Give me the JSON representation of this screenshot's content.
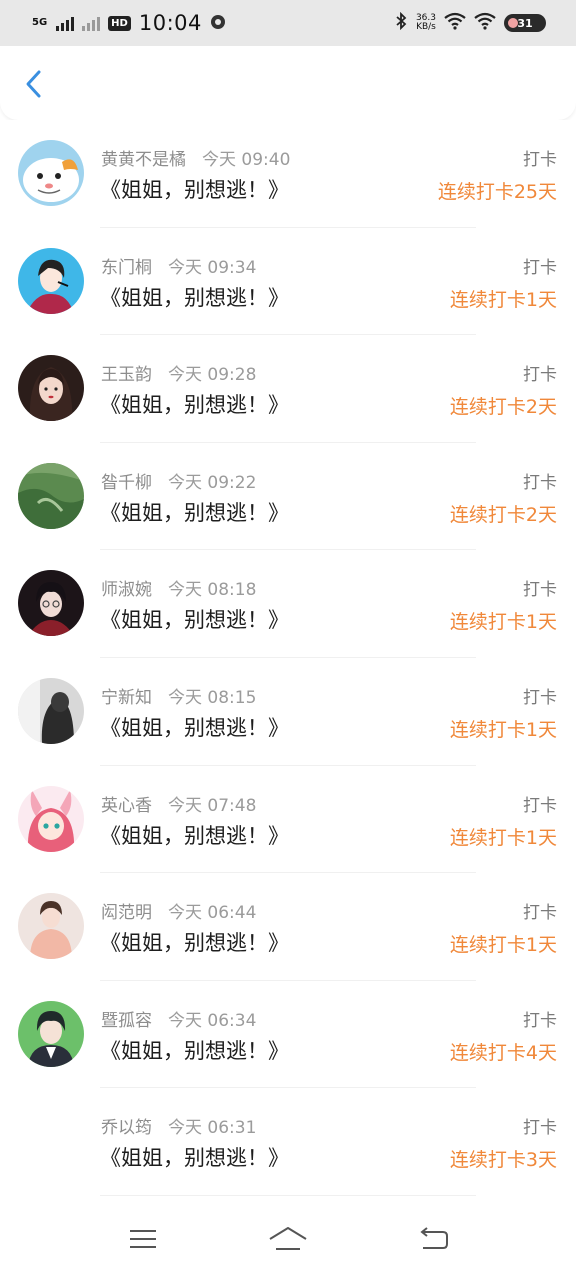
{
  "status_bar": {
    "network": "5G",
    "hd": "HD",
    "time": "10:04",
    "speed_value": "36.3",
    "speed_unit": "KB/s",
    "battery": "31"
  },
  "icons": {
    "back": "chevron-left-icon",
    "menu": "menu-icon",
    "home": "home-icon",
    "return": "return-icon"
  },
  "colors": {
    "accent": "#3a8fe0",
    "streak": "#f0883a",
    "meta": "#8d8d8d"
  },
  "feed": [
    {
      "name": "黄黄不是橘",
      "time": "今天 09:40",
      "book": "《姐姐，别想逃！》",
      "tag": "打卡",
      "streak": "连续打卡25天",
      "avatar": "hamster-cartoon"
    },
    {
      "name": "东门桐",
      "time": "今天 09:34",
      "book": "《姐姐，别想逃！》",
      "tag": "打卡",
      "streak": "连续打卡1天",
      "avatar": "illustrated-woman"
    },
    {
      "name": "王玉韵",
      "time": "今天 09:28",
      "book": "《姐姐，别想逃！》",
      "tag": "打卡",
      "streak": "连续打卡2天",
      "avatar": "anime-girl-dark"
    },
    {
      "name": "昝千柳",
      "time": "今天 09:22",
      "book": "《姐姐，别想逃！》",
      "tag": "打卡",
      "streak": "连续打卡2天",
      "avatar": "green-mountain"
    },
    {
      "name": "师淑婉",
      "time": "今天 08:18",
      "book": "《姐姐，别想逃！》",
      "tag": "打卡",
      "streak": "连续打卡1天",
      "avatar": "anime-boy-dark"
    },
    {
      "name": "宁新知",
      "time": "今天 08:15",
      "book": "《姐姐，别想逃！》",
      "tag": "打卡",
      "streak": "连续打卡1天",
      "avatar": "gray-photo"
    },
    {
      "name": "英心香",
      "time": "今天 07:48",
      "book": "《姐姐，别想逃！》",
      "tag": "打卡",
      "streak": "连续打卡1天",
      "avatar": "anime-girl-pink"
    },
    {
      "name": "闳范明",
      "time": "今天 06:44",
      "book": "《姐姐，别想逃！》",
      "tag": "打卡",
      "streak": "连续打卡1天",
      "avatar": "girl-pink-sweater"
    },
    {
      "name": "暨孤容",
      "time": "今天 06:34",
      "book": "《姐姐，别想逃！》",
      "tag": "打卡",
      "streak": "连续打卡4天",
      "avatar": "anime-boy-green"
    },
    {
      "name": "乔以筠",
      "time": "今天 06:31",
      "book": "《姐姐，别想逃！》",
      "tag": "打卡",
      "streak": "连续打卡3天",
      "avatar": "none"
    }
  ]
}
